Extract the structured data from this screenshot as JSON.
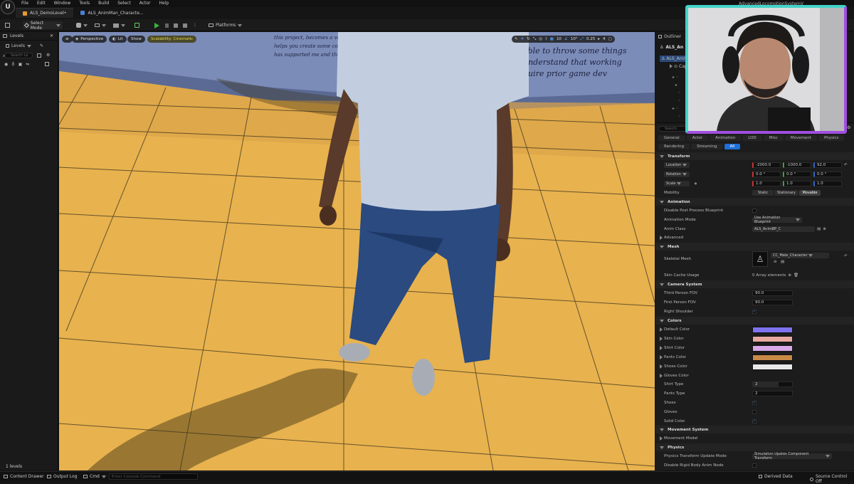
{
  "window": {
    "title": "AdvancedLocomotionSystemV"
  },
  "menu": [
    "File",
    "Edit",
    "Window",
    "Tools",
    "Build",
    "Select",
    "Actor",
    "Help"
  ],
  "tabs": [
    {
      "label": "ALS_DemoLevel•",
      "active": true
    },
    {
      "label": "ALS_AnimMan_Characte...",
      "active": false
    }
  ],
  "toolbar": {
    "mode": "Select Mode",
    "platforms": "Platforms"
  },
  "levels_panel": {
    "title": "Levels",
    "dropdown": "Levels",
    "search_placeholder": "Search Le",
    "footer": "1 levels"
  },
  "viewport": {
    "perspective": "Perspective",
    "lit": "Lit",
    "show": "Show",
    "scalability": "Scalability: Cinematic",
    "grid_snap": "10",
    "rot_snap": "10°",
    "scale_snap": "0.25",
    "cam_speed": "4",
    "wall_text_left": "this project, becomes a valuable learning... helps you create some cool stuff... has supported me and this project...",
    "wall_text_right": "able to throw some things understand that working quire prior game dev"
  },
  "outliner": {
    "title": "Outliner",
    "root": "ALS_An",
    "child": "ALS_Anim",
    "sub": "Caps"
  },
  "details": {
    "search_placeholder": "Search",
    "tabs_row1": [
      "General",
      "Actor",
      "Animation",
      "LOD",
      "Misc",
      "Movement",
      "Physics"
    ],
    "tabs_row2": [
      "Rendering",
      "Streaming",
      "All"
    ],
    "transform": {
      "title": "Transform",
      "location_label": "Location",
      "location": [
        "-2000.0",
        "-1000.0",
        "92.0"
      ],
      "rotation_label": "Rotation",
      "rotation": [
        "0.0 °",
        "0.0 °",
        "0.0 °"
      ],
      "scale_label": "Scale",
      "scale": [
        "1.0",
        "1.0",
        "1.0"
      ],
      "mobility_label": "Mobility",
      "mobility": [
        "Static",
        "Stationary",
        "Movable"
      ]
    },
    "animation": {
      "title": "Animation",
      "disable_pp": "Disable Post Process Blueprint",
      "mode_label": "Animation Mode",
      "mode_value": "Use Animation Blueprint",
      "class_label": "Anim Class",
      "class_value": "ALS_AnimBP_C",
      "advanced": "Advanced"
    },
    "mesh": {
      "title": "Mesh",
      "skeletal_label": "Skeletal Mesh",
      "skeletal_value": "CC_Male_Character",
      "skin_cache_label": "Skin Cache Usage",
      "skin_cache_value": "0 Array elements"
    },
    "camera": {
      "title": "Camera System",
      "tp_fov_label": "Third Person FOV",
      "tp_fov": "90.0",
      "fp_fov_label": "First Person FOV",
      "fp_fov": "90.0",
      "right_shoulder": "Right Shoulder"
    },
    "colors": {
      "title": "Colors",
      "items": [
        {
          "label": "Default Color",
          "color": "#7e72f0"
        },
        {
          "label": "Skin Color",
          "color": "#e8a8a0"
        },
        {
          "label": "Shirt Color",
          "color": "#d8a8e8"
        },
        {
          "label": "Pants Color",
          "color": "#c98a48"
        },
        {
          "label": "Shoes Color",
          "color": "#e8e8e8"
        },
        {
          "label": "Gloves Color",
          "color": ""
        }
      ],
      "shirt_type_label": "Shirt Type",
      "shirt_type": "2",
      "pants_type_label": "Pants Type",
      "pants_type": "2",
      "shoes": "Shoes",
      "gloves": "Gloves",
      "solid_color": "Solid Color"
    },
    "movement": {
      "title": "Movement System",
      "model": "Movement Model"
    },
    "physics": {
      "title": "Physics",
      "ptu_label": "Physics Transform Update Mode",
      "ptu_value": "Simulation Upates Component Transform",
      "disable_rb": "Disable Rigid Body Anim Node"
    }
  },
  "statusbar": {
    "content_drawer": "Content Drawer",
    "output_log": "Output Log",
    "cmd": "Cmd",
    "console_placeholder": "Enter Console Command",
    "derived_data": "Derived Data",
    "source_control": "Source Control Off"
  }
}
